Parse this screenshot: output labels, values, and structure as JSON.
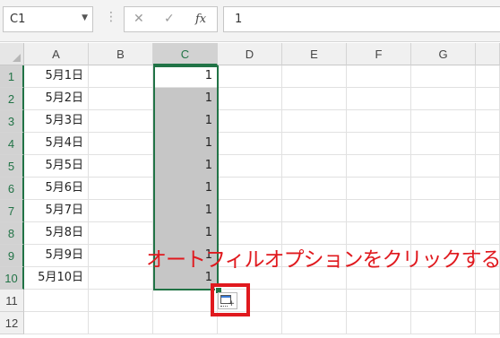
{
  "formula_bar": {
    "name_box": "C1",
    "formula_value": "1",
    "fx_label": "fx",
    "cancel_glyph": "✕",
    "enter_glyph": "✓"
  },
  "columns": [
    "A",
    "B",
    "C",
    "D",
    "E",
    "F",
    "G"
  ],
  "rows": [
    "1",
    "2",
    "3",
    "4",
    "5",
    "6",
    "7",
    "8",
    "9",
    "10",
    "11",
    "12"
  ],
  "cells": {
    "A": [
      "5月1日",
      "5月2日",
      "5月3日",
      "5月4日",
      "5月5日",
      "5月6日",
      "5月7日",
      "5月8日",
      "5月9日",
      "5月10日",
      "",
      ""
    ],
    "C": [
      "1",
      "1",
      "1",
      "1",
      "1",
      "1",
      "1",
      "1",
      "1",
      "1",
      "",
      ""
    ]
  },
  "selection": {
    "range": "C1:C10",
    "active_cell": "C1"
  },
  "annotation": {
    "text": "オートフィルオプションをクリックする",
    "color": "#e0191e"
  },
  "autofill_options": {
    "icon": "autofill-options-icon"
  },
  "accent_color": "#217346"
}
